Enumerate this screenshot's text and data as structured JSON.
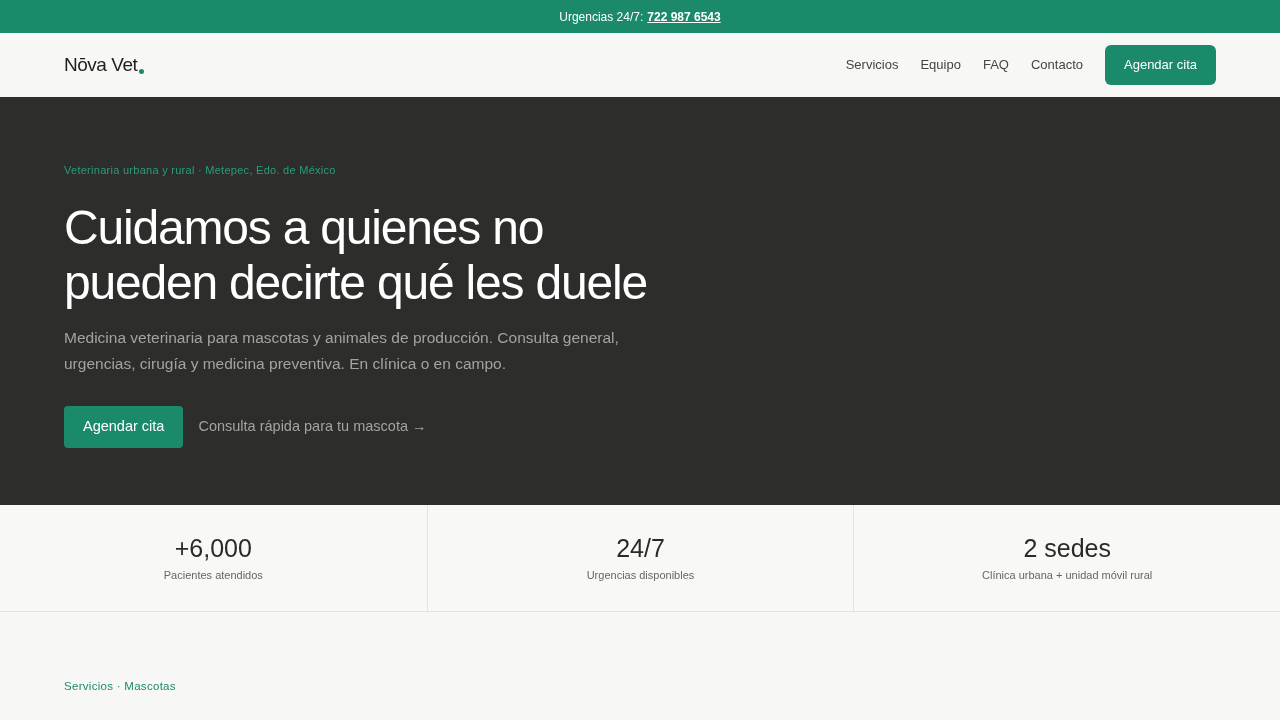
{
  "top_bar": {
    "label": "Urgencias 24/7:",
    "phone": "722 987 6543"
  },
  "nav": {
    "logo": "Nōva Vet",
    "links": [
      "Servicios",
      "Equipo",
      "FAQ",
      "Contacto"
    ],
    "cta": "Agendar cita"
  },
  "hero": {
    "eyebrow": "Veterinaria urbana y rural · Metepec, Edo. de México",
    "title_lines": [
      "Cuidamos a quienes no",
      "pueden decirte qué les duele"
    ],
    "description": "Medicina veterinaria para mascotas y animales de producción. Consulta general, urgencias, cirugía y medicina preventiva. En clínica o en campo.",
    "primary_button": "Agendar cita",
    "secondary_link": "Consulta rápida para tu mascota →"
  },
  "stats": [
    {
      "value": "+6,000",
      "label": "Pacientes atendidos"
    },
    {
      "value": "24/7",
      "label": "Urgencias disponibles"
    },
    {
      "value": "2 sedes",
      "label": "Clínica urbana + unidad móvil rural"
    }
  ],
  "section": {
    "eyebrow": "Servicios · Mascotas"
  }
}
